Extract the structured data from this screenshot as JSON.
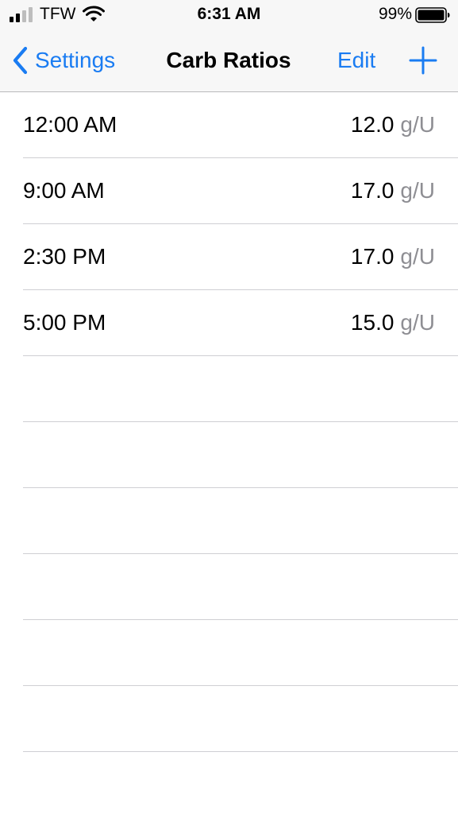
{
  "status_bar": {
    "carrier": "TFW",
    "time": "6:31 AM",
    "battery_percent": "99%",
    "icons": [
      "cellular-signal-icon",
      "wifi-icon",
      "battery-icon"
    ]
  },
  "nav": {
    "back_label": "Settings",
    "title": "Carb Ratios",
    "edit_label": "Edit",
    "add_icon": "plus-icon"
  },
  "colors": {
    "accent": "#1a7cf2",
    "unit_gray": "#8e8e93",
    "bar_background": "#f7f7f7",
    "separator": "#cfcfd3"
  },
  "schedule": [
    {
      "time": "12:00 AM",
      "value": "12.0",
      "unit": "g/U"
    },
    {
      "time": "9:00 AM",
      "value": "17.0",
      "unit": "g/U"
    },
    {
      "time": "2:30 PM",
      "value": "17.0",
      "unit": "g/U"
    },
    {
      "time": "5:00 PM",
      "value": "15.0",
      "unit": "g/U"
    }
  ]
}
